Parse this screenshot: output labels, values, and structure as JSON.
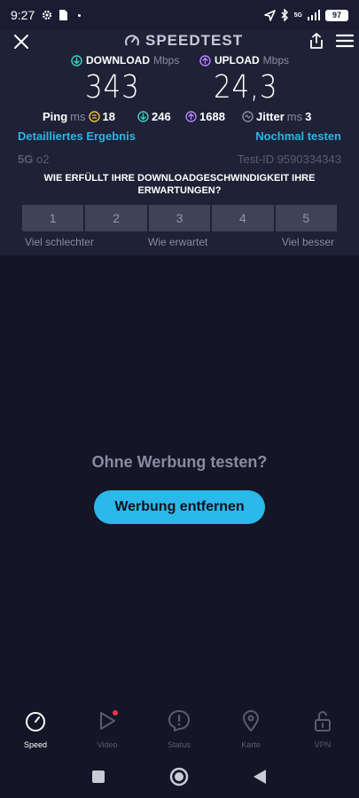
{
  "statusbar": {
    "time": "9:27",
    "network": "5G",
    "battery": "97"
  },
  "header": {
    "brand": "SPEEDTEST"
  },
  "download": {
    "label": "DOWNLOAD",
    "unit": "Mbps",
    "value": "343"
  },
  "upload": {
    "label": "UPLOAD",
    "unit": "Mbps",
    "value": "24,3"
  },
  "ping": {
    "label": "Ping",
    "unit": "ms",
    "idle": "18",
    "download": "246",
    "upload": "1688"
  },
  "jitter": {
    "label": "Jitter",
    "unit": "ms",
    "value": "3"
  },
  "links": {
    "details": "Detailliertes Ergebnis",
    "retest": "Nochmal testen"
  },
  "connection": {
    "type": "5G",
    "provider": "o2",
    "test_id": "Test-ID 9590334343"
  },
  "survey": {
    "question": "WIE ERFÜLLT IHRE DOWNLOADGESCHWINDIGKEIT IHRE ERWARTUNGEN?",
    "options": [
      "1",
      "2",
      "3",
      "4",
      "5"
    ],
    "scale_low": "Viel schlechter",
    "scale_mid": "Wie erwartet",
    "scale_high": "Viel besser"
  },
  "promo": {
    "title": "Ohne Werbung testen?",
    "button": "Werbung entfernen"
  },
  "tabs": [
    {
      "label": "Speed",
      "icon": "speedometer-icon"
    },
    {
      "label": "Video",
      "icon": "play-icon"
    },
    {
      "label": "Status",
      "icon": "alert-icon"
    },
    {
      "label": "Karte",
      "icon": "map-pin-icon"
    },
    {
      "label": "VPN",
      "icon": "lock-icon"
    }
  ],
  "colors": {
    "accent": "#2bb8ea",
    "download": "#3fd0c4",
    "upload": "#b580ff",
    "idle": "#f0c23c"
  }
}
